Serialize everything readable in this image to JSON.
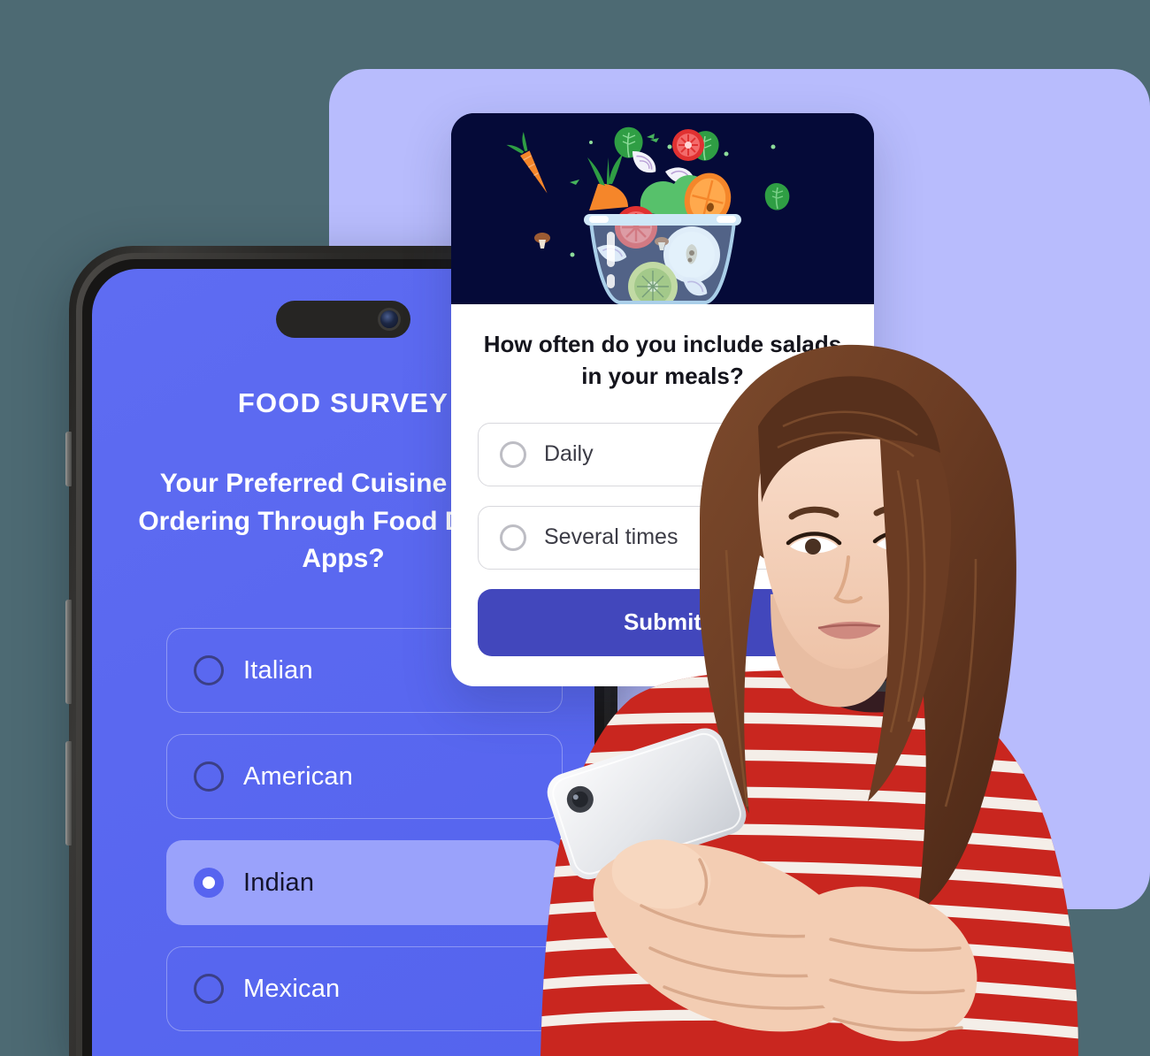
{
  "colors": {
    "page_background": "#4d6a73",
    "backdrop_panel": "#b8bcfd",
    "phone_screen": "#5a68f0",
    "selected_option": "#9aa2fb",
    "submit_button": "#4247bc",
    "illustration_background": "#050a38",
    "card_background": "#ffffff"
  },
  "phone_survey": {
    "title": "FOOD SURVEY",
    "question": "Your Preferred Cuisine When Ordering Through Food Delivery Apps?",
    "options": [
      {
        "label": "Italian",
        "selected": false
      },
      {
        "label": "American",
        "selected": false
      },
      {
        "label": "Indian",
        "selected": true
      },
      {
        "label": "Mexican",
        "selected": false
      }
    ]
  },
  "survey_card": {
    "illustration_alt": "salad-bowl-illustration",
    "question": "How often do you include salads in your meals?",
    "options": [
      {
        "label": "Daily",
        "selected": false
      },
      {
        "label": "Several times",
        "selected": false
      }
    ],
    "submit_label": "Submit"
  },
  "woman_photo": {
    "alt": "woman-using-smartphone"
  }
}
